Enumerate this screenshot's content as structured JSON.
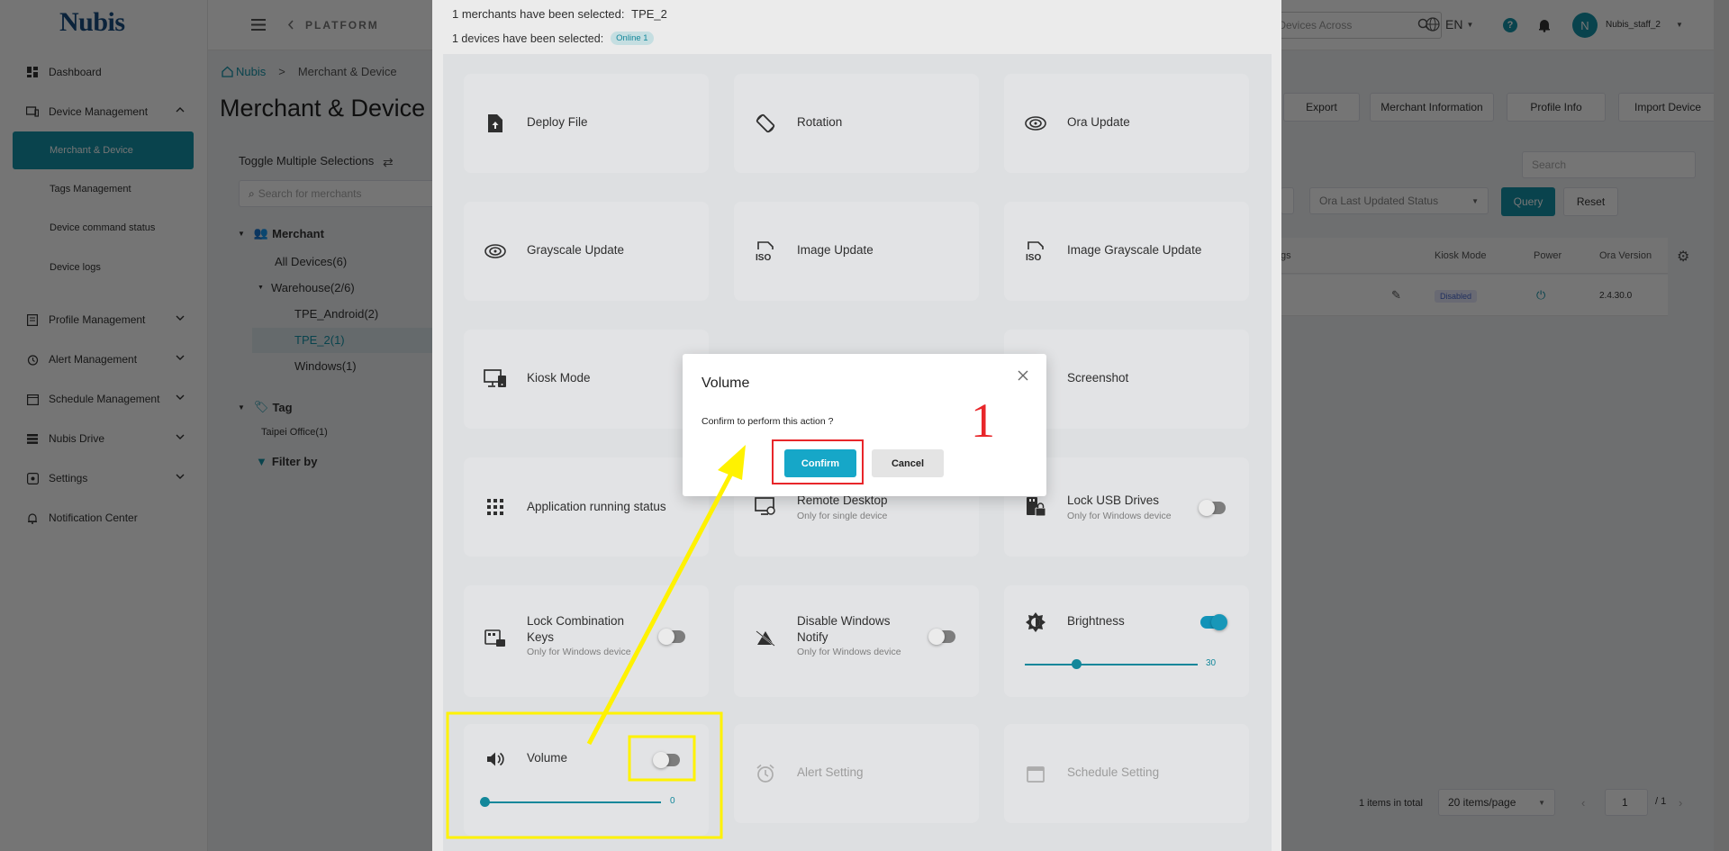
{
  "app": {
    "logo_text": "Nubis",
    "platform_label": "PLATFORM"
  },
  "sidebar": {
    "items": [
      {
        "label": "Dashboard",
        "icon": "dashboard-icon"
      },
      {
        "label": "Device Management",
        "icon": "device-icon",
        "expanded": true
      },
      {
        "label": "Profile Management",
        "icon": "profile-icon"
      },
      {
        "label": "Alert Management",
        "icon": "alarm-icon"
      },
      {
        "label": "Schedule Management",
        "icon": "calendar-icon"
      },
      {
        "label": "Nubis Drive",
        "icon": "drive-icon"
      },
      {
        "label": "Settings",
        "icon": "settings-icon"
      },
      {
        "label": "Notification Center",
        "icon": "bell-icon"
      }
    ],
    "sub_items": [
      "Merchant & Device",
      "Tags Management",
      "Device command status",
      "Device logs"
    ]
  },
  "header": {
    "search_placeholder": "r Devices Across",
    "language": "EN",
    "avatar_letter": "N",
    "user_name": "Nubis_staff_2"
  },
  "main": {
    "breadcrumb": [
      "Nubis",
      "Merchant & Device"
    ],
    "title": "Merchant & Device",
    "toggle_multiple": "Toggle Multiple Selections",
    "search_merchants_placeholder": "Search for merchants",
    "tree": {
      "merchant_label": "Merchant",
      "all_devices": "All Devices(6)",
      "warehouse": "Warehouse(2/6)",
      "children": [
        "TPE_Android(2)",
        "TPE_2(1)",
        "Windows(1)"
      ],
      "tag_label": "Tag",
      "tag_item": "Taipei Office(1)",
      "filter_by": "Filter by"
    },
    "top_buttons": [
      "Export",
      "Merchant Information",
      "Profile Info",
      "Import Device"
    ],
    "search_placeholder": "Search",
    "ora_status_placeholder": "Ora Last Updated Status",
    "query_label": "Query",
    "reset_label": "Reset",
    "columns": [
      "gs",
      "Kiosk Mode",
      "Power",
      "Ora Version"
    ],
    "row": {
      "kiosk": "Disabled",
      "ora_version": "2.4.30.0"
    },
    "pagination": {
      "total": "1 items in total",
      "page_size": "20 items/page",
      "page": "1",
      "pages": "/ 1"
    }
  },
  "drawer": {
    "merchants_selected": "1 merchants have been selected:",
    "merchant_name": "TPE_2",
    "devices_selected": "1 devices have been selected:",
    "online_badge": "Online 1",
    "cards": {
      "deploy_file": "Deploy File",
      "rotation": "Rotation",
      "ora_update": "Ora Update",
      "grayscale_update": "Grayscale Update",
      "image_update": "Image Update",
      "image_grayscale_update": "Image Grayscale Update",
      "kiosk_mode": "Kiosk Mode",
      "screenshot": "Screenshot",
      "app_running": "Application running status",
      "remote_desktop": "Remote Desktop",
      "remote_desktop_sub": "Only for single device",
      "lock_usb": "Lock USB Drives",
      "lock_usb_sub": "Only for Windows device",
      "lock_combo": "Lock Combination Keys",
      "lock_combo_sub": "Only for Windows device",
      "disable_notify": "Disable Windows Notify",
      "disable_notify_sub": "Only for Windows device",
      "brightness": "Brightness",
      "brightness_value": "30",
      "volume": "Volume",
      "volume_value": "0",
      "alert_setting": "Alert Setting",
      "schedule_setting": "Schedule Setting"
    },
    "brightness_level": 0.3,
    "volume_level": 0
  },
  "modal": {
    "title": "Volume",
    "message": "Confirm to perform this action ?",
    "confirm_label": "Confirm",
    "cancel_label": "Cancel"
  },
  "annotation": {
    "step_number": "1",
    "highlight_color": "#fff200",
    "marker_color": "#e8262a"
  },
  "colors": {
    "accent": "#1493a8",
    "confirm": "#16a7c8"
  }
}
